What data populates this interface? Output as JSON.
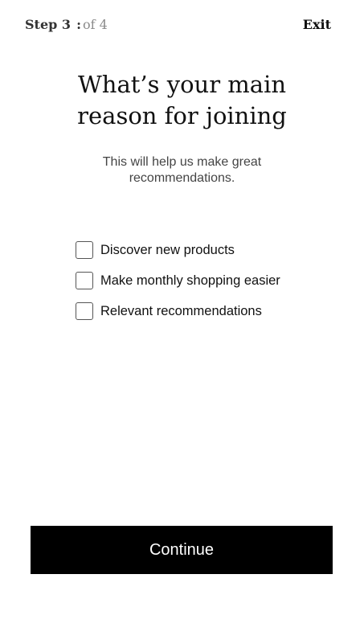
{
  "header": {
    "step_current": "Step 3",
    "step_separator": ":",
    "step_total": "of 4",
    "exit_label": "Exit"
  },
  "main": {
    "title": "What’s your main reason for joining",
    "subtitle": "This will help us make great recommendations.",
    "options": [
      {
        "label": "Discover new products",
        "checked": false
      },
      {
        "label": "Make monthly shopping easier",
        "checked": false
      },
      {
        "label": "Relevant recommendations",
        "checked": false
      }
    ]
  },
  "footer": {
    "continue_label": "Continue"
  },
  "colors": {
    "primary_button": "#000000",
    "button_text": "#ffffff",
    "muted_text": "#8a8a8a"
  }
}
